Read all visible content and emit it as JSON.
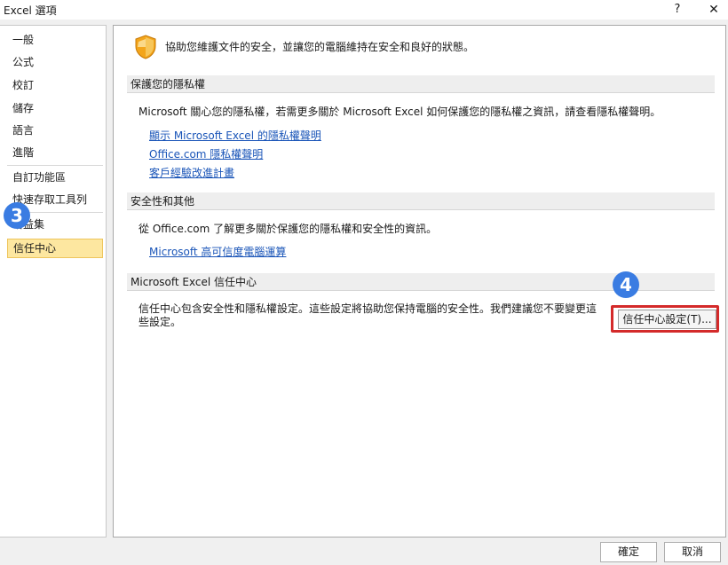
{
  "window": {
    "title": "Excel 選項",
    "help_label": "?",
    "close_label": "✕"
  },
  "sidebar": {
    "items": [
      {
        "label": "一般"
      },
      {
        "label": "公式"
      },
      {
        "label": "校訂"
      },
      {
        "label": "儲存"
      },
      {
        "label": "語言"
      },
      {
        "label": "進階"
      },
      {
        "label": "自訂功能區"
      },
      {
        "label": "快速存取工具列"
      },
      {
        "label": "增益集"
      },
      {
        "label": "信任中心",
        "active": true
      }
    ]
  },
  "annotations": {
    "step3": "3",
    "step4": "4"
  },
  "main": {
    "intro": "協助您維護文件的安全，並讓您的電腦維持在安全和良好的狀態。",
    "privacy": {
      "header": "保護您的隱私權",
      "text": "Microsoft 關心您的隱私權，若需更多關於 Microsoft Excel 如何保護您的隱私權之資訊，請查看隱私權聲明。",
      "links": [
        "顯示 Microsoft Excel 的隱私權聲明",
        "Office.com 隱私權聲明",
        "客戶經驗改進計畫"
      ]
    },
    "security": {
      "header": "安全性和其他",
      "text": "從 Office.com 了解更多關於保護您的隱私權和安全性的資訊。",
      "link": "Microsoft 高可信度電腦運算"
    },
    "trust_center": {
      "header": "Microsoft Excel 信任中心",
      "text": "信任中心包含安全性和隱私權設定。這些設定將協助您保持電腦的安全性。我們建議您不要變更這些設定。",
      "button": "信任中心設定(T)..."
    }
  },
  "footer": {
    "ok": "確定",
    "cancel": "取消"
  },
  "colors": {
    "active_nav_bg": "#fde7a0",
    "link": "#1a55b8",
    "badge": "#3a7ce2",
    "highlight_border": "#d42a2a"
  }
}
